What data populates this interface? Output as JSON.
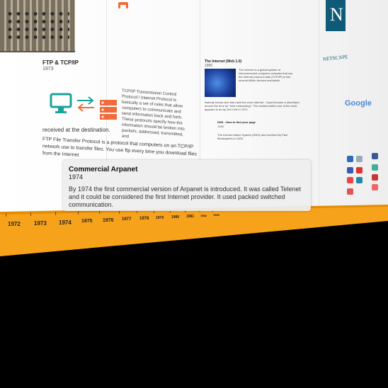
{
  "timeline": {
    "years": [
      "1972",
      "1973",
      "1974",
      "1975",
      "1976",
      "1977",
      "1978",
      "1979",
      "1980",
      "1981",
      "1982",
      "1983"
    ]
  },
  "cards": {
    "ftp": {
      "title": "FTP & TCP/IP",
      "year": "1973",
      "tcp_text": "TCP/IP Transmission Control Protocol / Internet Protocol is basically a set of rules that allow computers to communicate and send information back and forth. These protocols specify how the information should be broken into packets, addressed, transmitted, and",
      "received": "received at the destination.",
      "ftp_text": "FTP File Transfer Protocol is a protocol that computers on an TCP/IP network use to transfer files. You use ftp every time you download files from the Internet"
    },
    "web": {
      "title": "The Internet (Web 1.0)",
      "year": "1990",
      "body": "The Internet is a global system of interconnected computer networks that use the Internet protocol suite (TCP/IP) to link several billion devices worldwide.",
      "body2": "Nobody knows who first used the word Internet - it just became a shorthand around the time for \"inter-networking\". The earliest written use of the word appears to be by Vint Cerf in 1974."
    },
    "dns": {
      "title": "DNS - How to find your page",
      "year": "1983",
      "body": "The Domain Name System (DNS) was invented by Paul Mockapetris in 1983."
    },
    "netscape": {
      "word": "NETSCAPE",
      "letter": "N"
    },
    "google": {
      "word": "Google"
    }
  },
  "tooltip": {
    "title": "Commercial Arpanet",
    "year": "1974",
    "body": "By 1974 the first commercial version of Arpanet is introduced. It was called Telenet and it could be considered the first Internet provider. It used packed switched communication."
  },
  "colors": {
    "orange": "#f7a21b",
    "teal": "#1aa39a",
    "server_red": "#f26b3a"
  }
}
